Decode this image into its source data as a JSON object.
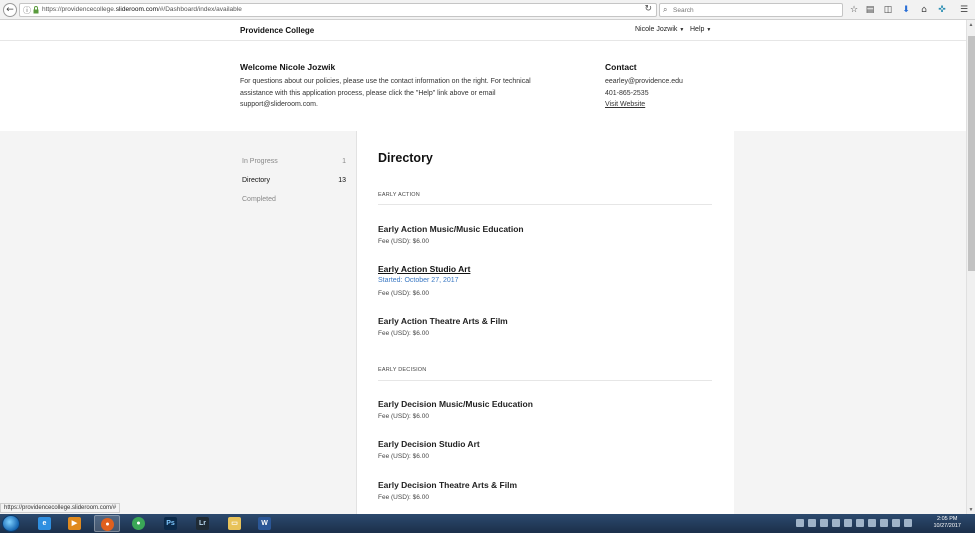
{
  "browser": {
    "url_prefix": "https://providencecollege.",
    "url_domain": "slideroom.com",
    "url_suffix": "/#/Dashboard/index/available",
    "search_placeholder": "Search"
  },
  "header": {
    "brand": "Providence College",
    "user_menu": "Nicole Jozwik",
    "help_menu": "Help"
  },
  "welcome": {
    "title": "Welcome Nicole Jozwik",
    "text": "For questions about our policies, please use the contact information on the right. For technical assistance with this application process, please click the \"Help\" link above or email support@slideroom.com."
  },
  "contact": {
    "title": "Contact",
    "email": "eearley@providence.edu",
    "phone": "401-865-2535",
    "website_label": "Visit Website"
  },
  "sidebar": {
    "items": [
      {
        "label": "In Progress",
        "count": "1"
      },
      {
        "label": "Directory",
        "count": "13"
      },
      {
        "label": "Completed",
        "count": ""
      }
    ]
  },
  "directory": {
    "title": "Directory",
    "sections": [
      {
        "label": "EARLY ACTION",
        "programs": [
          {
            "title": "Early Action Music/Music Education",
            "fee": "Fee (USD): $6.00"
          },
          {
            "title": "Early Action Studio Art",
            "started": "Started: October 27, 2017",
            "fee": "Fee (USD): $6.00"
          },
          {
            "title": "Early Action Theatre Arts & Film",
            "fee": "Fee (USD): $6.00"
          }
        ]
      },
      {
        "label": "EARLY DECISION",
        "programs": [
          {
            "title": "Early Decision Music/Music Education",
            "fee": "Fee (USD): $6.00"
          },
          {
            "title": "Early Decision Studio Art",
            "fee": "Fee (USD): $6.00"
          },
          {
            "title": "Early Decision Theatre Arts & Film",
            "fee": "Fee (USD): $6.00"
          }
        ]
      }
    ]
  },
  "status_bar": {
    "link_preview": "https://providencecollege.slideroom.com/#"
  },
  "taskbar": {
    "time": "2:05 PM",
    "date": "10/27/2017"
  },
  "colors": {
    "link_blue": "#3a78c3",
    "panel_bg": "#f4f4f4",
    "taskbar": "#1b2f4a"
  }
}
